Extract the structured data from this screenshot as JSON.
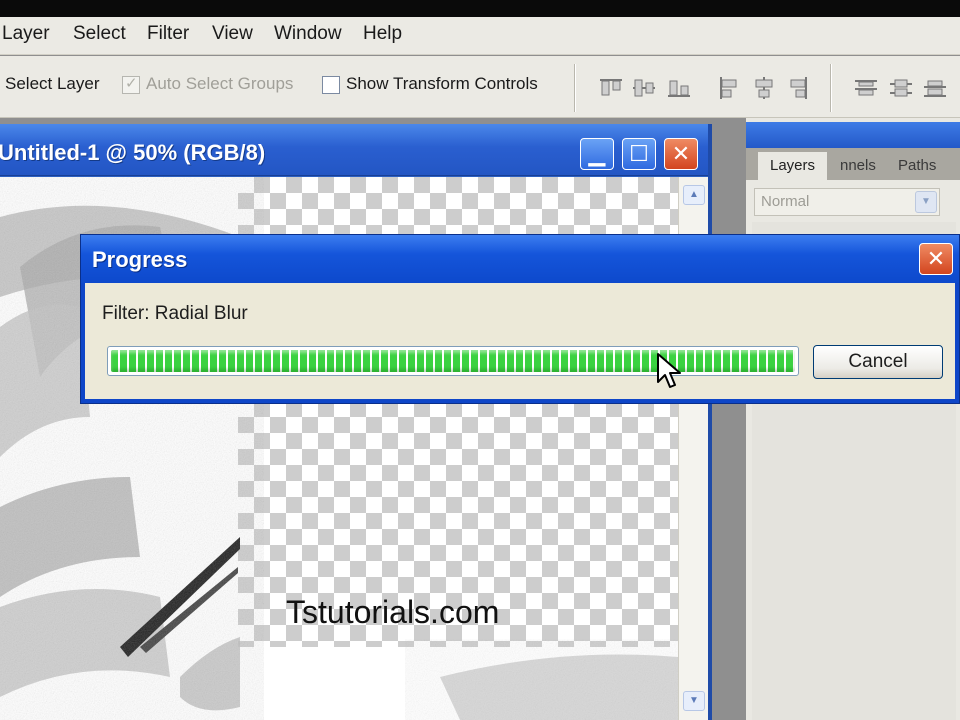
{
  "menu": {
    "items": [
      "Layer",
      "Select",
      "Filter",
      "View",
      "Window",
      "Help"
    ]
  },
  "options": {
    "select_layer_label": "Select Layer",
    "auto_select_groups_label": "Auto Select Groups",
    "auto_select_groups_checked": true,
    "show_transform_label": "Show Transform Controls",
    "show_transform_checked": false,
    "align_icons": [
      "align-top-icon",
      "align-vcenter-icon",
      "align-bottom-icon",
      "align-left-icon",
      "align-hcenter-icon",
      "align-right-icon",
      "distribute-top-icon",
      "distribute-vcenter-icon",
      "distribute-bottom-icon"
    ]
  },
  "document": {
    "title": "Untitled-1 @ 50% (RGB/8)",
    "watermark": "Tstutorials.com"
  },
  "layers_panel": {
    "tabs": [
      "Layers",
      "nnels",
      "Paths"
    ],
    "blend_mode": "Normal"
  },
  "progress_dialog": {
    "title": "Progress",
    "label": "Filter: Radial Blur",
    "progress": 1.0,
    "cancel_label": "Cancel"
  },
  "colors": {
    "xp_blue": "#2459c8",
    "progress_green": "#3bd241",
    "close_red": "#d3451f"
  }
}
